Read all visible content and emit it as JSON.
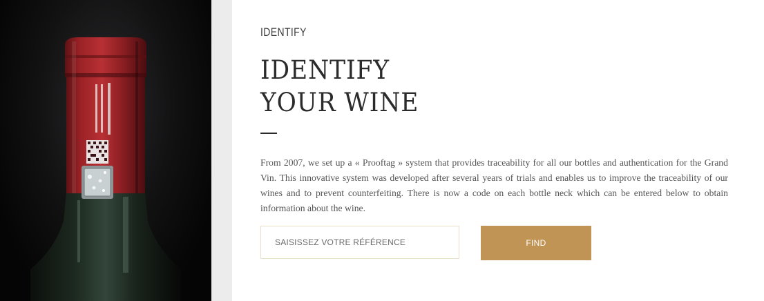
{
  "section": {
    "eyebrow": "IDENTIFY",
    "title_line1": "IDENTIFY",
    "title_line2": "YOUR WINE",
    "description": "From 2007, we set up a « Prooftag » system that provides traceability for all our bottles and authentication for the Grand Vin. This innovative system was developed after several years of trials and enables us to improve the traceability of our wines and to prevent counterfeiting. There is now a code on each bottle neck which can be entered below to obtain information about the wine."
  },
  "form": {
    "input_placeholder": "SAISISSEZ VOTRE RÉFÉRENCE",
    "input_value": "",
    "button_label": "FIND"
  },
  "colors": {
    "accent": "#c09455",
    "input_border": "#e7dfc6",
    "capsule_red": "#a3272b",
    "text_dark": "#2b2b2b",
    "strip_grey": "#ececec"
  }
}
